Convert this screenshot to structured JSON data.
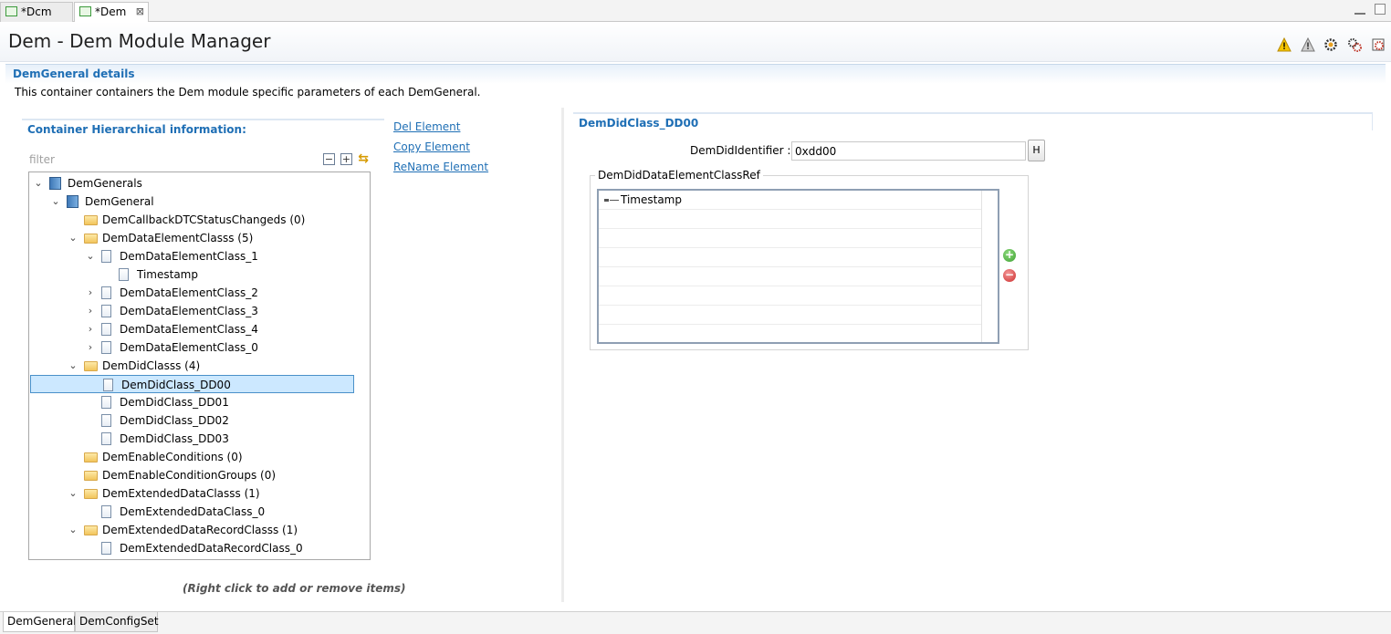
{
  "editor_tabs": [
    {
      "label": "*Dcm",
      "active": false
    },
    {
      "label": "*Dem",
      "active": true,
      "close": "⊠"
    }
  ],
  "header": {
    "title": "Dem - Dem Module Manager",
    "icons": [
      "warning-icon",
      "alert-icon",
      "settings-gear-icon",
      "multi-gear-icon",
      "generate-icon"
    ]
  },
  "section": {
    "title": "DemGeneral details",
    "description": "This container containers the Dem module specific parameters of each DemGeneral."
  },
  "left_panel": {
    "title": "Container Hierarchical information:",
    "filter_placeholder": "filter",
    "tool_icons": [
      "collapse-all-icon",
      "expand-all-icon",
      "sync-icon"
    ],
    "hint": "(Right click to add or remove items)",
    "tree": [
      {
        "label": "DemGenerals",
        "level": 0,
        "twisty": "expanded",
        "icon": "book"
      },
      {
        "label": "DemGeneral",
        "level": 1,
        "twisty": "expanded",
        "icon": "book"
      },
      {
        "label": "DemCallbackDTCStatusChangeds (0)",
        "level": 2,
        "twisty": "none",
        "icon": "folder"
      },
      {
        "label": "DemDataElementClasss (5)",
        "level": 2,
        "twisty": "expanded",
        "icon": "folder"
      },
      {
        "label": "DemDataElementClass_1",
        "level": 3,
        "twisty": "expanded",
        "icon": "doc"
      },
      {
        "label": "Timestamp",
        "level": 4,
        "twisty": "none",
        "icon": "doc"
      },
      {
        "label": "DemDataElementClass_2",
        "level": 3,
        "twisty": "collapsed",
        "icon": "doc"
      },
      {
        "label": "DemDataElementClass_3",
        "level": 3,
        "twisty": "collapsed",
        "icon": "doc"
      },
      {
        "label": "DemDataElementClass_4",
        "level": 3,
        "twisty": "collapsed",
        "icon": "doc"
      },
      {
        "label": "DemDataElementClass_0",
        "level": 3,
        "twisty": "collapsed",
        "icon": "doc"
      },
      {
        "label": "DemDidClasss (4)",
        "level": 2,
        "twisty": "expanded",
        "icon": "folder"
      },
      {
        "label": "DemDidClass_DD00",
        "level": 3,
        "twisty": "none",
        "icon": "doc",
        "selected": true
      },
      {
        "label": "DemDidClass_DD01",
        "level": 3,
        "twisty": "none",
        "icon": "doc"
      },
      {
        "label": "DemDidClass_DD02",
        "level": 3,
        "twisty": "none",
        "icon": "doc"
      },
      {
        "label": "DemDidClass_DD03",
        "level": 3,
        "twisty": "none",
        "icon": "doc"
      },
      {
        "label": "DemEnableConditions (0)",
        "level": 2,
        "twisty": "none",
        "icon": "folder"
      },
      {
        "label": "DemEnableConditionGroups (0)",
        "level": 2,
        "twisty": "none",
        "icon": "folder"
      },
      {
        "label": "DemExtendedDataClasss (1)",
        "level": 2,
        "twisty": "expanded",
        "icon": "folder"
      },
      {
        "label": "DemExtendedDataClass_0",
        "level": 3,
        "twisty": "none",
        "icon": "doc"
      },
      {
        "label": "DemExtendedDataRecordClasss (1)",
        "level": 2,
        "twisty": "expanded",
        "icon": "folder"
      },
      {
        "label": "DemExtendedDataRecordClass_0",
        "level": 3,
        "twisty": "none",
        "icon": "doc"
      }
    ]
  },
  "actions": {
    "del": "Del Element",
    "copy": "Copy Element",
    "rename": "ReName Element"
  },
  "right_panel": {
    "title": "DemDidClass_DD00",
    "identifier_label": "DemDidIdentifier :",
    "identifier_value": "0xdd00",
    "hex_button": "H",
    "ref_group_label": "DemDidDataElementClassRef",
    "ref_rows": [
      "Timestamp",
      "",
      "",
      "",
      "",
      "",
      "",
      ""
    ],
    "add_icon": "add-icon",
    "remove_icon": "remove-icon"
  },
  "bottom_tabs": [
    {
      "label": "DemGeneral",
      "active": true
    },
    {
      "label": "DemConfigSet",
      "active": false
    }
  ]
}
